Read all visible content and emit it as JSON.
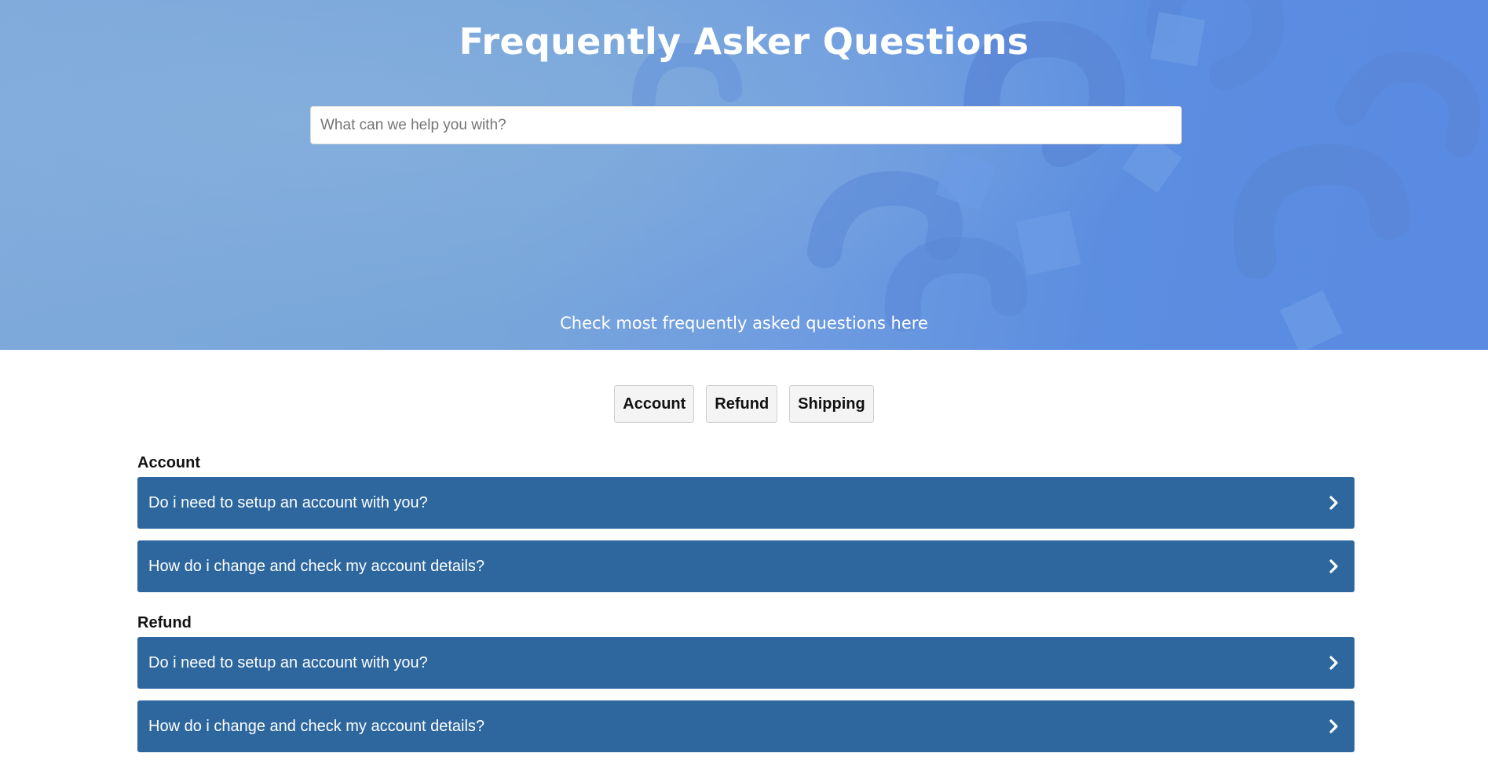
{
  "hero": {
    "title": "Frequently Asker Questions",
    "search_placeholder": "What can we help you with?",
    "subtitle": "Check most frequently asked questions here"
  },
  "tabs": [
    {
      "label": "Account"
    },
    {
      "label": "Refund"
    },
    {
      "label": "Shipping"
    }
  ],
  "sections": [
    {
      "heading": "Account",
      "items": [
        {
          "question": "Do i need to setup an account with you?"
        },
        {
          "question": "How do i change and check my account details?"
        }
      ]
    },
    {
      "heading": "Refund",
      "items": [
        {
          "question": "Do i need to setup an account with you?"
        },
        {
          "question": "How do i change and check my account details?"
        }
      ]
    }
  ],
  "colors": {
    "faq_bar": "#2d679e",
    "hero_blue": "#6f9ce0"
  },
  "icons": {
    "chevron": "chevron-right-icon"
  }
}
